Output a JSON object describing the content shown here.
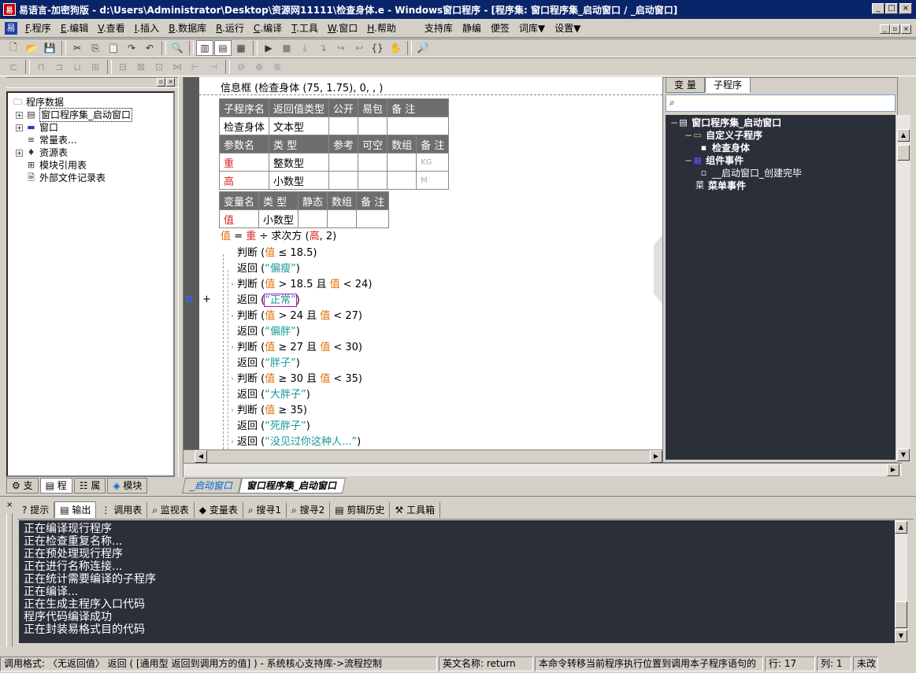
{
  "window": {
    "title": "易语言-加密狗版 - d:\\Users\\Administrator\\Desktop\\资源网11111\\检查身体.e - Windows窗口程序 - [程序集: 窗口程序集_启动窗口 / _启动窗口]",
    "min": "_",
    "max": "□",
    "close": "×"
  },
  "menu": [
    {
      "key": "F",
      "label": ".程序"
    },
    {
      "key": "E",
      "label": ".编辑"
    },
    {
      "key": "V",
      "label": ".查看"
    },
    {
      "key": "I",
      "label": ".插入"
    },
    {
      "key": "B",
      "label": ".数据库"
    },
    {
      "key": "R",
      "label": ".运行"
    },
    {
      "key": "C",
      "label": ".编译"
    },
    {
      "key": "T",
      "label": ".工具"
    },
    {
      "key": "W",
      "label": ".窗口"
    },
    {
      "key": "H",
      "label": ".帮助"
    },
    {
      "key": "",
      "label": "支持库"
    },
    {
      "key": "",
      "label": "静编"
    },
    {
      "key": "",
      "label": "便签"
    },
    {
      "key": "",
      "label": "词库▼"
    },
    {
      "key": "",
      "label": "设置▼"
    }
  ],
  "left_tree": {
    "items": [
      {
        "label": "程序数据",
        "icon": "folder-icon",
        "level": 0
      },
      {
        "label": "窗口程序集_启动窗口",
        "icon": "module-icon",
        "level": 1,
        "expander": "+",
        "selected": true
      },
      {
        "label": "窗口",
        "icon": "window-icon",
        "level": 1,
        "expander": "+"
      },
      {
        "label": "常量表...",
        "icon": "constant-icon",
        "level": 1
      },
      {
        "label": "资源表",
        "icon": "resource-icon",
        "level": 1,
        "expander": "+"
      },
      {
        "label": "模块引用表",
        "icon": "module-ref-icon",
        "level": 1
      },
      {
        "label": "外部文件记录表",
        "icon": "file-icon",
        "level": 1
      }
    ]
  },
  "left_tabs": [
    "支",
    "程",
    "属",
    "模块"
  ],
  "editor": {
    "header_line": "信息框 (检查身体 (75, 1.75), 0, , )",
    "sub_table": {
      "head1": [
        "子程序名",
        "返回值类型",
        "公开",
        "易包",
        "备 注"
      ],
      "row1": [
        "检查身体",
        "文本型",
        "",
        "",
        ""
      ],
      "head2": [
        "参数名",
        "类 型",
        "参考",
        "可空",
        "数组",
        "备 注"
      ],
      "params": [
        {
          "name": "重",
          "type": "整数型",
          "note": "KG"
        },
        {
          "name": "高",
          "type": "小数型",
          "note": "M"
        }
      ]
    },
    "var_table": {
      "head": [
        "变量名",
        "类 型",
        "静态",
        "数组",
        "备 注"
      ],
      "row": [
        "值",
        "小数型",
        "",
        "",
        ""
      ]
    },
    "lines": [
      {
        "segs": [
          [
            "orng",
            "值"
          ],
          [
            "",
            "  =  "
          ],
          [
            "red",
            "重"
          ],
          [
            "",
            " ÷ 求次方 ("
          ],
          [
            "red",
            "高"
          ],
          [
            "",
            ", 2)"
          ]
        ]
      },
      {
        "segs": [
          [
            "",
            "判断 ("
          ],
          [
            "orng",
            "值"
          ],
          [
            "",
            "  ≤  18.5)"
          ]
        ]
      },
      {
        "segs": [
          [
            "",
            "返回 ("
          ],
          [
            "teal",
            "“偏瘦”"
          ],
          [
            "",
            ")"
          ]
        ]
      },
      {
        "segs": [
          [
            "",
            "判断 ("
          ],
          [
            "orng",
            "值"
          ],
          [
            "",
            "  >  18.5 且 "
          ],
          [
            "orng",
            "值"
          ],
          [
            "",
            "  <  24)"
          ]
        ]
      },
      {
        "segs": [
          [
            "",
            "返回 ("
          ],
          [
            "teal",
            "“正常”"
          ],
          [
            "",
            ")"
          ]
        ]
      },
      {
        "segs": [
          [
            "",
            "判断 ("
          ],
          [
            "orng",
            "值"
          ],
          [
            "",
            "  >  24 且 "
          ],
          [
            "orng",
            "值"
          ],
          [
            "",
            "  <  27)"
          ]
        ]
      },
      {
        "segs": [
          [
            "",
            "返回 ("
          ],
          [
            "teal",
            "“偏胖”"
          ],
          [
            "",
            ")"
          ]
        ]
      },
      {
        "segs": [
          [
            "",
            "判断 ("
          ],
          [
            "orng",
            "值"
          ],
          [
            "",
            "  ≥  27 且 "
          ],
          [
            "orng",
            "值"
          ],
          [
            "",
            "  <  30)"
          ]
        ]
      },
      {
        "segs": [
          [
            "",
            "返回 ("
          ],
          [
            "teal",
            "“胖子”"
          ],
          [
            "",
            ")"
          ]
        ]
      },
      {
        "segs": [
          [
            "",
            "判断 ("
          ],
          [
            "orng",
            "值"
          ],
          [
            "",
            "  ≥  30 且 "
          ],
          [
            "orng",
            "值"
          ],
          [
            "",
            "  <  35)"
          ]
        ]
      },
      {
        "segs": [
          [
            "",
            "返回 ("
          ],
          [
            "teal",
            "“大胖子”"
          ],
          [
            "",
            ")"
          ]
        ]
      },
      {
        "segs": [
          [
            "",
            "判断 ("
          ],
          [
            "orng",
            "值"
          ],
          [
            "",
            "  ≥  35)"
          ]
        ]
      },
      {
        "segs": [
          [
            "",
            "返回 ("
          ],
          [
            "teal",
            "“死胖子”"
          ],
          [
            "",
            ")"
          ]
        ]
      },
      {
        "segs": [
          [
            "",
            "返回 ("
          ],
          [
            "teal",
            "“没见过你这种人...”"
          ],
          [
            "",
            ")"
          ]
        ]
      }
    ]
  },
  "editor_tabs": [
    "_启动窗口",
    "窗口程序集_启动窗口"
  ],
  "right_panel": {
    "tabs": [
      "变 量",
      "子程序"
    ],
    "tree": [
      {
        "label": "窗口程序集_启动窗口",
        "level": 0,
        "bold": true,
        "icon": "module-icon"
      },
      {
        "label": "自定义子程序",
        "level": 1,
        "bold": true,
        "icon": "folder-icon"
      },
      {
        "label": "检查身体",
        "level": 2,
        "bold": true,
        "icon": "subroutine-icon"
      },
      {
        "label": "组件事件",
        "level": 1,
        "bold": true,
        "icon": "component-icon"
      },
      {
        "label": "__启动窗口_创建完毕",
        "level": 2,
        "bold": false,
        "icon": "event-icon"
      },
      {
        "label": "菜单事件",
        "level": 1,
        "bold": true,
        "icon": "menu-icon"
      }
    ]
  },
  "output_tabs": [
    "提示",
    "输出",
    "调用表",
    "监视表",
    "变量表",
    "搜寻1",
    "搜寻2",
    "剪辑历史",
    "工具箱"
  ],
  "output_lines": [
    "正在编译现行程序",
    "正在检查重复名称...",
    "正在预处理现行程序",
    "正在进行名称连接...",
    "正在统计需要编译的子程序",
    "正在编译...",
    "正在生成主程序入口代码",
    "程序代码编译成功",
    "正在封装易格式目的代码"
  ],
  "status": {
    "call_format": "调用格式: 〈无返回值〉 返回 ( [通用型 返回到调用方的值] ) - 系统核心支持库->流程控制",
    "english": "英文名称: return",
    "desc": "本命令转移当前程序执行位置到调用本子程序语句的",
    "row": "行: 17",
    "col": "列: 1",
    "changed": "未改"
  }
}
